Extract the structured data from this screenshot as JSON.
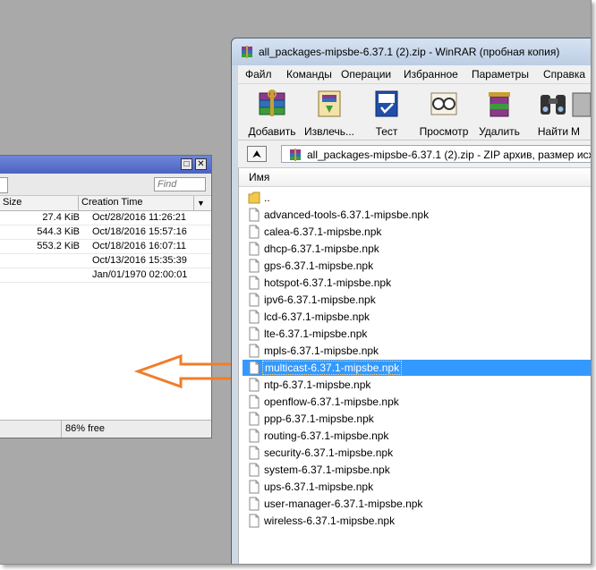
{
  "file_window": {
    "search": {
      "placeholder": "Find"
    },
    "columns": {
      "size": "Size",
      "creation_time": "Creation Time"
    },
    "rows": [
      {
        "size": "27.4 KiB",
        "time": "Oct/28/2016 11:26:21"
      },
      {
        "size": "544.3 KiB",
        "time": "Oct/18/2016 15:57:16"
      },
      {
        "size": "553.2 KiB",
        "time": "Oct/18/2016 16:07:11"
      },
      {
        "size": "",
        "time": "Oct/13/2016 15:35:39"
      },
      {
        "size": "",
        "time": "Jan/01/1970 02:00:01"
      }
    ],
    "status": {
      "free": "86% free"
    }
  },
  "arrow": {
    "color": "#f07d2a",
    "icon": "arrow-left-icon"
  },
  "winrar": {
    "title": "all_packages-mipsbe-6.37.1 (2).zip - WinRAR (пробная копия)",
    "menu": [
      "Файл",
      "Команды",
      "Операции",
      "Избранное",
      "Параметры",
      "Справка"
    ],
    "toolbar": [
      {
        "label": "Добавить",
        "icon": "archive-add-icon"
      },
      {
        "label": "Извлечь...",
        "icon": "extract-icon"
      },
      {
        "label": "Тест",
        "icon": "test-icon"
      },
      {
        "label": "Просмотр",
        "icon": "view-icon"
      },
      {
        "label": "Удалить",
        "icon": "delete-icon"
      },
      {
        "label": "Найти",
        "icon": "find-icon"
      },
      {
        "label": "М",
        "icon": "wizard-icon"
      }
    ],
    "address": "all_packages-mipsbe-6.37.1 (2).zip - ZIP архив, размер исх",
    "column_name": "Имя",
    "selected_index": 9,
    "files": [
      "..",
      "advanced-tools-6.37.1-mipsbe.npk",
      "calea-6.37.1-mipsbe.npk",
      "dhcp-6.37.1-mipsbe.npk",
      "gps-6.37.1-mipsbe.npk",
      "hotspot-6.37.1-mipsbe.npk",
      "ipv6-6.37.1-mipsbe.npk",
      "lcd-6.37.1-mipsbe.npk",
      "lte-6.37.1-mipsbe.npk",
      "mpls-6.37.1-mipsbe.npk",
      "multicast-6.37.1-mipsbe.npk",
      "ntp-6.37.1-mipsbe.npk",
      "openflow-6.37.1-mipsbe.npk",
      "ppp-6.37.1-mipsbe.npk",
      "routing-6.37.1-mipsbe.npk",
      "security-6.37.1-mipsbe.npk",
      "system-6.37.1-mipsbe.npk",
      "ups-6.37.1-mipsbe.npk",
      "user-manager-6.37.1-mipsbe.npk",
      "wireless-6.37.1-mipsbe.npk"
    ]
  }
}
